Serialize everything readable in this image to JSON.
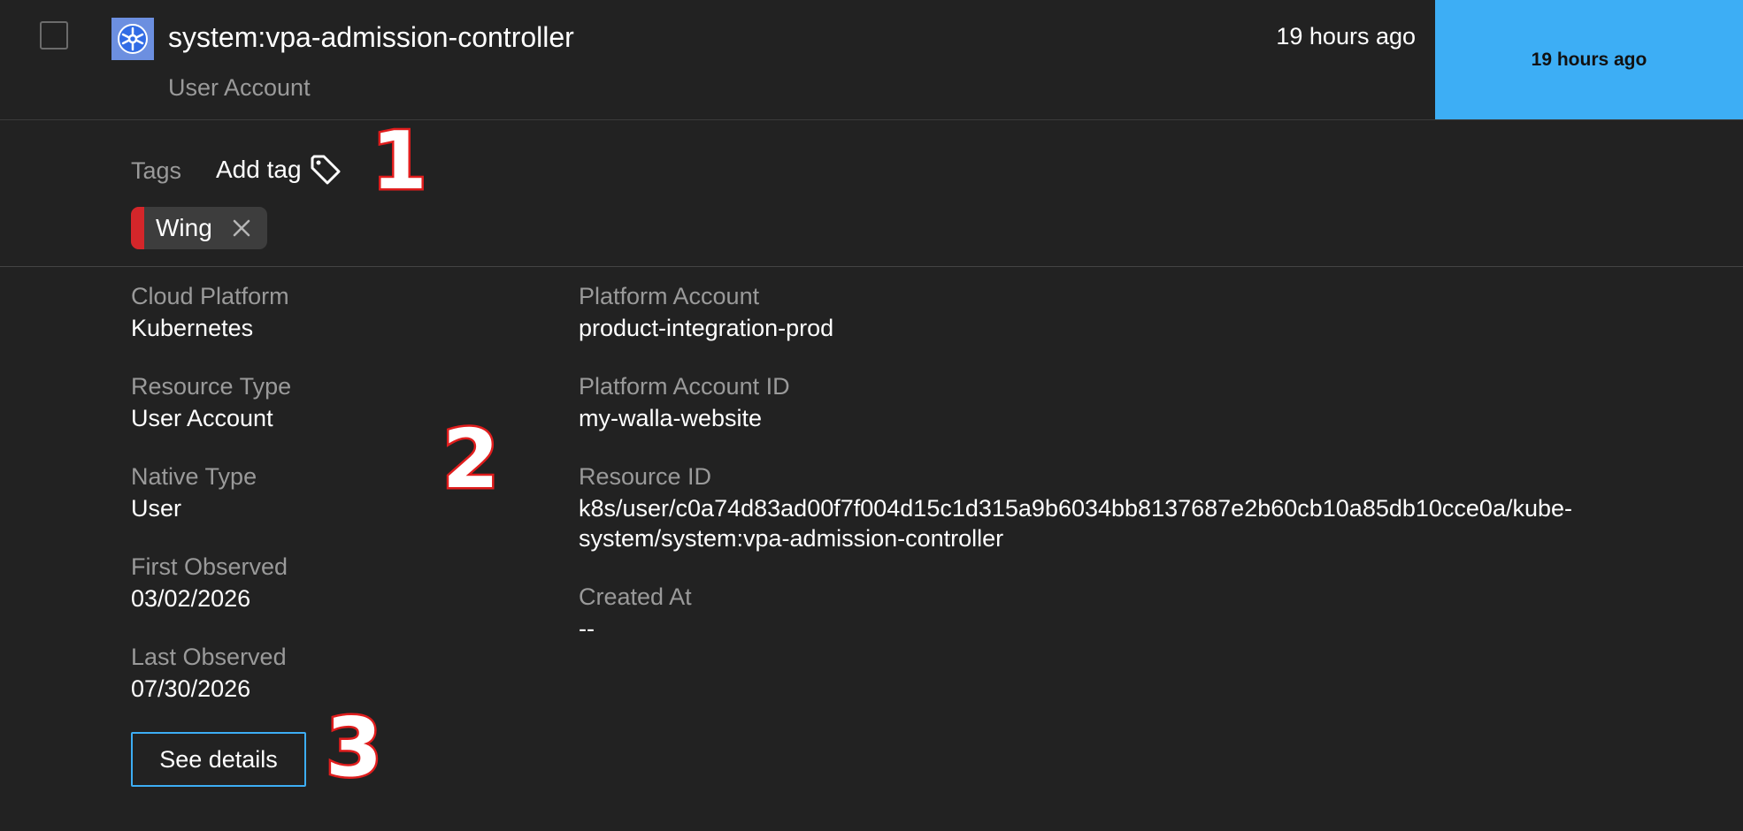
{
  "row": {
    "name": "system:vpa-admission-controller",
    "subtype": "User Account",
    "time_ago": "19 hours ago",
    "time_highlight": "19 hours ago"
  },
  "tags": {
    "label": "Tags",
    "add_label": "Add tag",
    "items": [
      {
        "text": "Wing",
        "color": "#d4262a"
      }
    ]
  },
  "details": {
    "cloud_platform": {
      "label": "Cloud Platform",
      "value": "Kubernetes"
    },
    "resource_type": {
      "label": "Resource Type",
      "value": "User Account"
    },
    "native_type": {
      "label": "Native Type",
      "value": "User"
    },
    "first_observed": {
      "label": "First Observed",
      "value": "03/02/2026"
    },
    "last_observed": {
      "label": "Last Observed",
      "value": "07/30/2026"
    },
    "platform_account": {
      "label": "Platform Account",
      "value": "product-integration-prod"
    },
    "platform_account_id": {
      "label": "Platform Account ID",
      "value": "my-walla-website"
    },
    "resource_id": {
      "label": "Resource ID",
      "value": "k8s/user/c0a74d83ad00f7f004d15c1d315a9b6034bb8137687e2b60cb10a85db10cce0a/kube-system/system:vpa-admission-controller"
    },
    "created_at": {
      "label": "Created At",
      "value": "--"
    }
  },
  "actions": {
    "see_details": "See details"
  },
  "annotations": {
    "m1": "1",
    "m2": "2",
    "m3": "3"
  },
  "colors": {
    "accent": "#3daef5",
    "background": "#222222",
    "tag_red": "#d4262a"
  },
  "icons": [
    "kubernetes-logo-icon",
    "tag-icon",
    "close-icon"
  ]
}
